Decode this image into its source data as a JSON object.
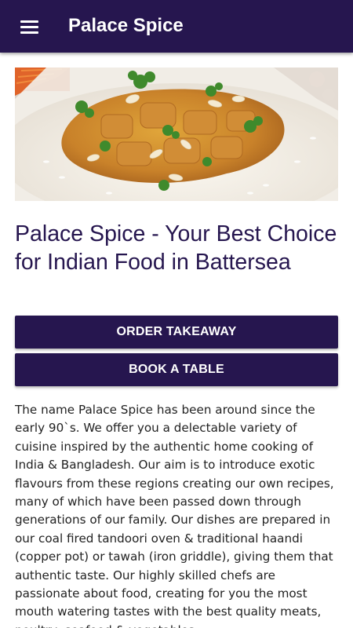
{
  "appbar": {
    "title": "Palace Spice",
    "menu_icon": "hamburger-menu-icon",
    "background": "#26164f"
  },
  "hero": {
    "image": "curry-with-rice-photo"
  },
  "main": {
    "headline": "Palace Spice - Your Best Choice for Indian Food in Battersea",
    "buttons": {
      "order_label": "ORDER TAKEAWAY",
      "book_label": "BOOK A TABLE"
    },
    "description": "The name Palace Spice has been around since the early 90`s. We offer you a delectable variety of cuisine inspired by the authentic home cooking of India & Bangladesh. Our aim is to introduce exotic flavours from these regions creating our own recipes, many of which have been passed down through generations of our family. Our dishes are prepared in our coal fired tandoori oven & traditional haandi (copper pot) or tawah (iron griddle), giving them that authentic taste. Our highly skilled chefs are passionate about food, creating for you the most mouth watering tastes with the best quality meats, poultry, seafood & vegetables"
  },
  "colors": {
    "primary": "#26164f",
    "on_primary": "#ffffff"
  }
}
